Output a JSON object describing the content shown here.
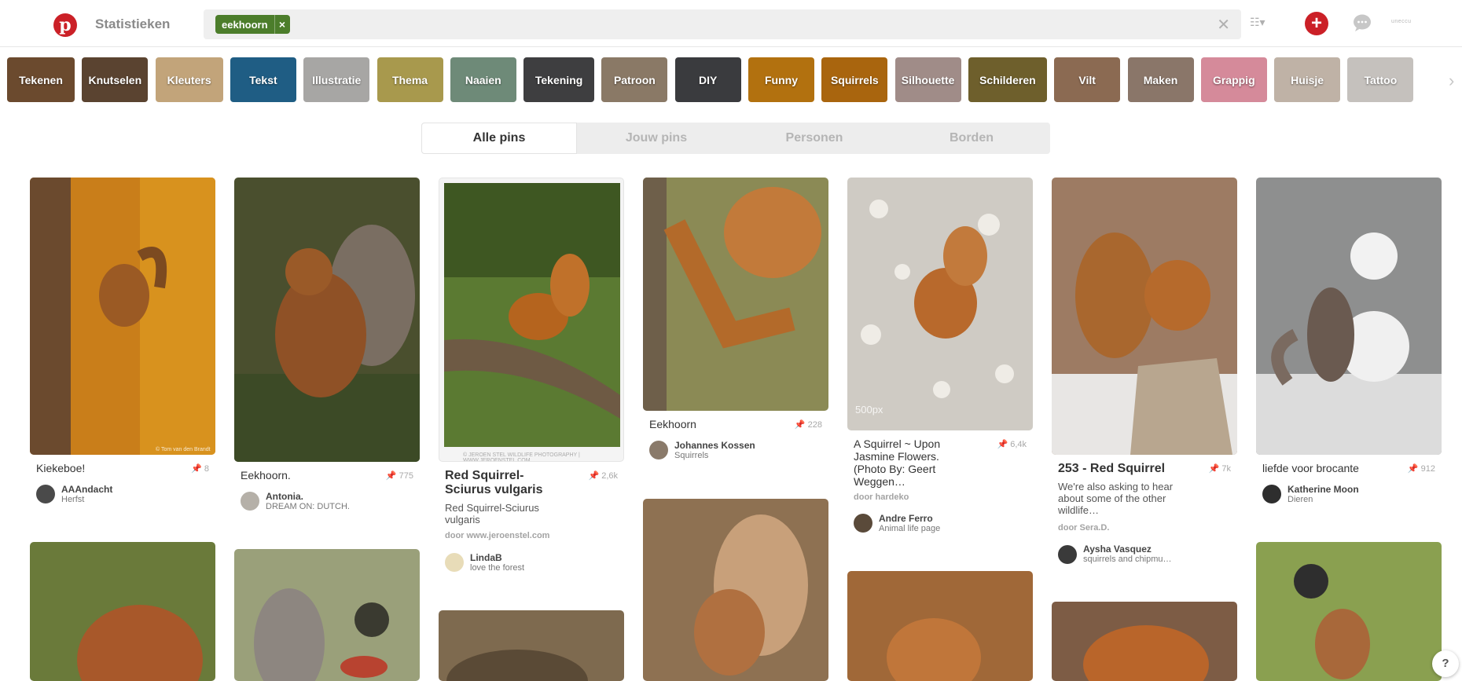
{
  "header": {
    "logo_letter": "p",
    "stats_label": "Statistieken",
    "search_chip": "eekhoorn",
    "chip_close": "×",
    "search_clear": "✕",
    "list_icon": "☷▾",
    "plus": "+",
    "user_tag": "uneccu"
  },
  "categories": [
    {
      "label": "Tekenen",
      "color": "#6b4a2e"
    },
    {
      "label": "Knutselen",
      "color": "#5a4330"
    },
    {
      "label": "Kleuters",
      "color": "#c2a47a"
    },
    {
      "label": "Tekst",
      "color": "#1f5d84"
    },
    {
      "label": "Illustratie",
      "color": "#a7a6a4"
    },
    {
      "label": "Thema",
      "color": "#a8994d"
    },
    {
      "label": "Naaien",
      "color": "#6e8a78"
    },
    {
      "label": "Tekening",
      "color": "#3e3e40"
    },
    {
      "label": "Patroon",
      "color": "#8a7966"
    },
    {
      "label": "DIY",
      "color": "#3a3b3e"
    },
    {
      "label": "Funny",
      "color": "#b2710f"
    },
    {
      "label": "Squirrels",
      "color": "#a9650e"
    },
    {
      "label": "Silhouette",
      "color": "#a08c88"
    },
    {
      "label": "Schilderen",
      "color": "#6e5f2c"
    },
    {
      "label": "Vilt",
      "color": "#8b6a52"
    },
    {
      "label": "Maken",
      "color": "#8a7669"
    },
    {
      "label": "Grappig",
      "color": "#d58a9a"
    },
    {
      "label": "Huisje",
      "color": "#bfb2a6"
    },
    {
      "label": "Tattoo",
      "color": "#c5c1bd"
    }
  ],
  "cats_arrow": "›",
  "tabs": [
    "Alle pins",
    "Jouw pins",
    "Personen",
    "Borden"
  ],
  "pins": [
    {
      "title": "Kiekeboe!",
      "count": "8",
      "pinner": "AAAndacht",
      "board": "Herfst",
      "color": "#c97e1a",
      "watermark": "© Tom van den Brandt"
    },
    {
      "title": "Eekhoorn.",
      "count": "775",
      "pinner": "Antonia.",
      "board": "DREAM ON: DUTCH.",
      "color": "#8f5126"
    },
    {
      "title": "Red Squirrel- Sciurus vulgaris",
      "count": "2,6k",
      "desc": "Red Squirrel-Sciurus vulgaris",
      "source": "door www.jeroenstel.com",
      "pinner": "LindaB",
      "board": "love the forest",
      "color": "#5b7a32",
      "watermark": "© JEROEN STEL WILDLIFE PHOTOGRAPHY | WWW.JEROENSTEL.COM"
    },
    {
      "title": "Eekhoorn",
      "count": "228",
      "pinner": "Johannes Kossen",
      "board": "Squirrels",
      "color": "#b36a2a"
    },
    {
      "title": "A Squirrel ~ Upon Jasmine Flowers. (Photo By: Geert Weggen…",
      "count": "6,4k",
      "source": "door hardeko",
      "pinner": "Andre Ferro",
      "board": "Animal life page",
      "color": "#cfcbc4",
      "watermark": "500px"
    },
    {
      "title": "253 - Red Squirrel",
      "count": "7k",
      "desc": "We're also asking to hear about some of the other wildlife…",
      "source": "door Sera.D.",
      "pinner": "Aysha Vasquez",
      "board": "squirrels and chipmu…",
      "color": "#9d7b63"
    },
    {
      "title": "liefde voor brocante",
      "count": "912",
      "pinner": "Katherine Moon",
      "board": "Dieren",
      "color": "#8e8f8f"
    }
  ],
  "lower_pins": [
    {
      "color": "#6a7a3a"
    },
    {
      "color": "#9aa07a"
    },
    {
      "color": "#7e6a4f"
    },
    {
      "color": "#8e7152"
    },
    {
      "color": "#a06838"
    },
    {
      "color": "#7d5c45"
    },
    {
      "color": "#8aa050"
    }
  ],
  "help": "?"
}
